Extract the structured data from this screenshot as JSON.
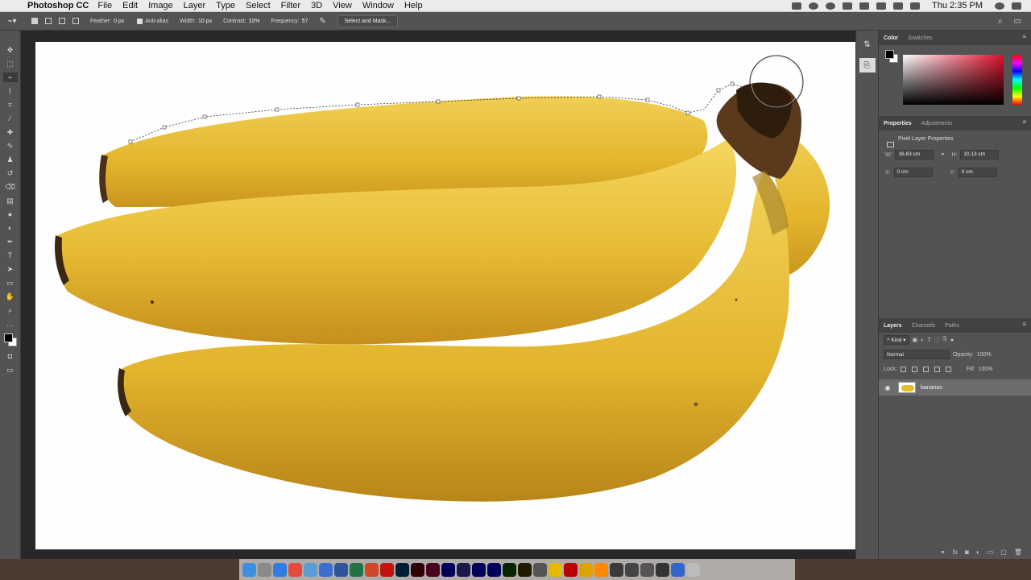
{
  "menubar": {
    "app_name": "Photoshop CC",
    "items": [
      "File",
      "Edit",
      "Image",
      "Layer",
      "Type",
      "Select",
      "Filter",
      "3D",
      "View",
      "Window",
      "Help"
    ],
    "clock": "Thu 2:35 PM"
  },
  "options": {
    "feather_label": "Feather:",
    "feather_value": "0 px",
    "antialias_label": "Anti-alias",
    "width_label": "Width:",
    "width_value": "10 px",
    "contrast_label": "Contrast:",
    "contrast_value": "10%",
    "frequency_label": "Frequency:",
    "frequency_value": "57",
    "select_mask_label": "Select and Mask..."
  },
  "color_panel": {
    "tabs": [
      "Color",
      "Swatches"
    ],
    "active_tab": "Color",
    "foreground": "#000000",
    "background": "#ffffff",
    "hue_color": "#e00f2a"
  },
  "properties_panel": {
    "tabs": [
      "Properties",
      "Adjustments"
    ],
    "title": "Pixel Layer Properties",
    "w_label": "W:",
    "w_value": "16.63 cm",
    "h_label": "H:",
    "h_value": "10.13 cm",
    "x_label": "X:",
    "x_value": "0 cm",
    "y_label": "Y:",
    "y_value": "0 cm"
  },
  "layers_panel": {
    "tabs": [
      "Layers",
      "Channels",
      "Paths"
    ],
    "filter_label": "Kind",
    "blend_mode": "Normal",
    "opacity_label": "Opacity:",
    "opacity_value": "100%",
    "lock_label": "Lock:",
    "fill_label": "Fill:",
    "fill_value": "100%",
    "layers": [
      {
        "name": "bananas",
        "visible": true
      }
    ]
  },
  "dock_apps": [
    "Finder",
    "Launchpad",
    "Safari",
    "Chrome",
    "Preview",
    "Keynote",
    "Word",
    "Excel",
    "PowerPoint",
    "Acrobat",
    "Ps",
    "Ai",
    "Id",
    "Pr",
    "Media Encoder",
    "Ae",
    "Au",
    "Dw",
    "Br",
    "Misc1",
    "Misc2",
    "FileZilla",
    "Misc3",
    "VLC",
    "Misc4",
    "Misc5",
    "Misc6",
    "Misc7",
    "Misc8",
    "Trash"
  ]
}
